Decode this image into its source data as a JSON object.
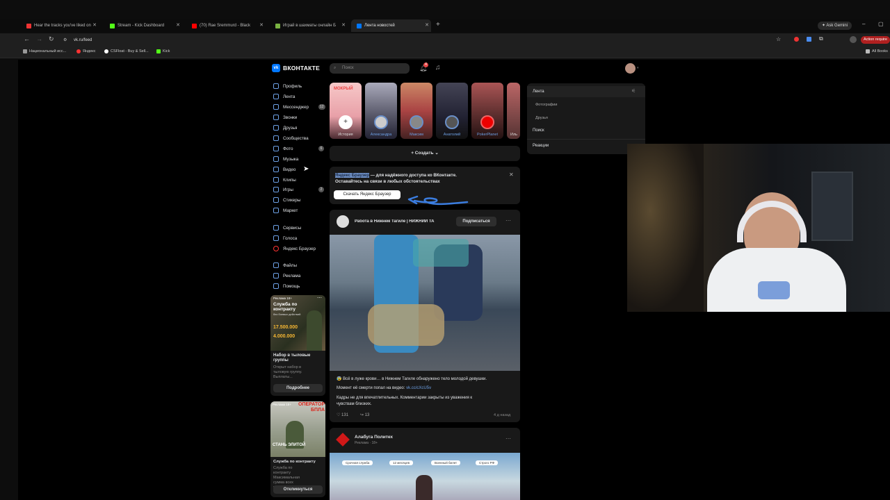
{
  "browser": {
    "tabs": [
      {
        "label": "Hear the tracks you've liked on",
        "color": "#e33"
      },
      {
        "label": "Stream - Kick Dashboard",
        "color": "#53fc18"
      },
      {
        "label": "(70) Rae Sremmurd - Black",
        "color": "#f00"
      },
      {
        "label": "Играй в шахматы онлайн Б",
        "color": "#7ab342"
      },
      {
        "label": "Лента новостей",
        "color": "#0077ff"
      }
    ],
    "url": "vk.ru/feed",
    "gemini_label": "Ask Gemini",
    "action_label": "Action require",
    "all_bookmarks": "All Books",
    "bookmarks": [
      "Национальный исс...",
      "Яндекс",
      "CSFloat - Buy & Sell...",
      "Kick"
    ]
  },
  "vk": {
    "logo": "ВКОНТАКТЕ",
    "search_placeholder": "Поиск",
    "notif_count": "4",
    "menu": [
      {
        "label": "Профиль",
        "count": ""
      },
      {
        "label": "Лента",
        "count": ""
      },
      {
        "label": "Мессенджер",
        "count": "12"
      },
      {
        "label": "Звонки",
        "count": ""
      },
      {
        "label": "Друзья",
        "count": ""
      },
      {
        "label": "Сообщества",
        "count": ""
      },
      {
        "label": "Фото",
        "count": "6"
      },
      {
        "label": "Музыка",
        "count": ""
      },
      {
        "label": "Видео",
        "count": ""
      },
      {
        "label": "Клипы",
        "count": ""
      },
      {
        "label": "Игры",
        "count": "2"
      },
      {
        "label": "Стикеры",
        "count": ""
      },
      {
        "label": "Маркет",
        "count": ""
      }
    ],
    "menu2": [
      "Сервисы",
      "Голоса",
      "Яндекс Браузер"
    ],
    "menu3": [
      "Файлы",
      "Реклама",
      "Помощь"
    ],
    "stories": [
      "История",
      "Александра",
      "Максим",
      "Анатолий",
      "PokerPlanet",
      "Иль"
    ],
    "create_label": "Создать",
    "banner": {
      "highlight": "Яндекс Браузер",
      "line1_rest": " — для надёжного доступа ко ВКонтакте.",
      "line2": "Оставайтесь на связи в любых обстоятельствах",
      "button": "Скачать Яндекс Браузер"
    },
    "post": {
      "author": "Работа в Нижнем Тагиле | НИЖНИЙ ТА",
      "subscribe": "Подписаться",
      "text1": "😰 Всё в луже крови… в Нижнем Тагиле обнаружено тело молодой девушки.",
      "text2a": "Момент её смерти попал на видео: ",
      "text2b": "vk.cc/cXcU5v",
      "text3": "Кадры не для впечатлительных. Комментарии закрыты из уважения к",
      "text4": "чувствам близких.",
      "likes": "131",
      "reposts": "13",
      "time": "4 д назад"
    },
    "post2": {
      "author": "Алабуга Политех",
      "sub": "Реклама · 18+",
      "tags": [
        "Срочная служба",
        "12 месяцев",
        "Военный билет",
        "Строго РФ"
      ]
    },
    "right_panel": {
      "title": "Лента",
      "items": [
        "Фотографии",
        "Друзья"
      ],
      "search": "Поиск",
      "reactions": "Реакции"
    },
    "ads": [
      {
        "badge": "Реклама 18+",
        "img_title": "Служба по контракту",
        "img_sub": "без боевых действий",
        "amount1": "17.500.000",
        "amount2": "4.000.000",
        "title": "Набор в тыловые группы",
        "desc": "Открыт набор в тыловую группу. Выплаты...",
        "button": "Подробнее"
      },
      {
        "badge": "Реклама 18+",
        "img_title": "ОПЕРАТОР БПЛА",
        "img_sub": "СТАНЬ ЭЛИТОЙ",
        "title": "Служба по контракту",
        "desc": "Служба по контракту Максимальная сумма всех выплат...",
        "button": "Откликнуться"
      }
    ]
  }
}
